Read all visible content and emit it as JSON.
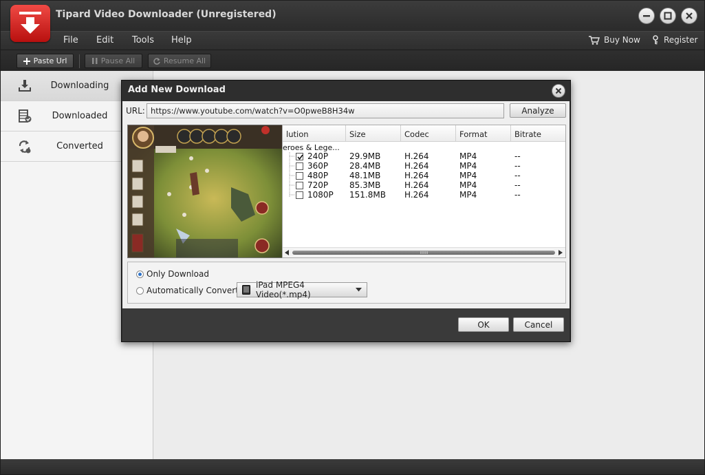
{
  "window": {
    "title": "Tipard Video Downloader (Unregistered)"
  },
  "menu": {
    "items": [
      "File",
      "Edit",
      "Tools",
      "Help"
    ],
    "buy_now": "Buy Now",
    "register": "Register"
  },
  "toolbar": {
    "paste_url": "Paste Url",
    "pause_all": "Pause All",
    "resume_all": "Resume All"
  },
  "sidebar": {
    "items": [
      {
        "label": "Downloading",
        "icon": "download-tray-icon",
        "selected": true
      },
      {
        "label": "Downloaded",
        "icon": "film-check-icon",
        "selected": false
      },
      {
        "label": "Converted",
        "icon": "convert-arrows-icon",
        "selected": false
      }
    ]
  },
  "dialog": {
    "title": "Add New Download",
    "url_label": "URL:",
    "url_value": "https://www.youtube.com/watch?v=O0pweB8H34w",
    "analyze_label": "Analyze",
    "table": {
      "columns": [
        "lution",
        "Size",
        "Codec",
        "Format",
        "Bitrate"
      ],
      "group": "eroes & Lege...",
      "rows": [
        {
          "resolution": "240P",
          "size": "29.9MB",
          "codec": "H.264",
          "format": "MP4",
          "bitrate": "--",
          "checked": true
        },
        {
          "resolution": "360P",
          "size": "28.4MB",
          "codec": "H.264",
          "format": "MP4",
          "bitrate": "--",
          "checked": false
        },
        {
          "resolution": "480P",
          "size": "48.1MB",
          "codec": "H.264",
          "format": "MP4",
          "bitrate": "--",
          "checked": false
        },
        {
          "resolution": "720P",
          "size": "85.3MB",
          "codec": "H.264",
          "format": "MP4",
          "bitrate": "--",
          "checked": false
        },
        {
          "resolution": "1080P",
          "size": "151.8MB",
          "codec": "H.264",
          "format": "MP4",
          "bitrate": "--",
          "checked": false
        }
      ]
    },
    "only_download_label": "Only Download",
    "auto_convert_label": "Automatically Convert to:",
    "convert_value": "iPad MPEG4 Video(*.mp4)",
    "ok_label": "OK",
    "cancel_label": "Cancel",
    "selected_option": "only_download"
  },
  "colors": {
    "accent_red": "#d42a24",
    "radio_blue": "#2f73c8",
    "dark_chrome": "#2e2e2e"
  }
}
